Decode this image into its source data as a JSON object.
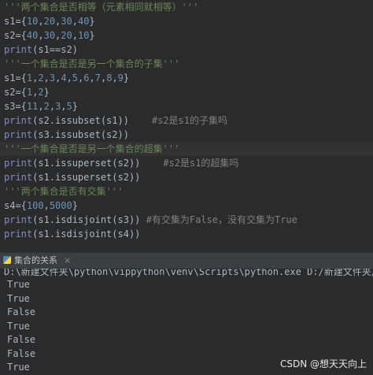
{
  "editor": {
    "lines": [
      {
        "parts": [
          {
            "t": "'''两个集合是否相等（元素相同就相等）'''",
            "c": "str"
          }
        ]
      },
      {
        "parts": [
          {
            "t": "s1={",
            "c": "op"
          },
          {
            "t": "10",
            "c": "num"
          },
          {
            "t": ",",
            "c": "op"
          },
          {
            "t": "20",
            "c": "num"
          },
          {
            "t": ",",
            "c": "op"
          },
          {
            "t": "30",
            "c": "num"
          },
          {
            "t": ",",
            "c": "op"
          },
          {
            "t": "40",
            "c": "num"
          },
          {
            "t": "}",
            "c": "op"
          }
        ]
      },
      {
        "parts": [
          {
            "t": "s2={",
            "c": "op"
          },
          {
            "t": "40",
            "c": "num"
          },
          {
            "t": ",",
            "c": "op"
          },
          {
            "t": "30",
            "c": "num"
          },
          {
            "t": ",",
            "c": "op"
          },
          {
            "t": "20",
            "c": "num"
          },
          {
            "t": ",",
            "c": "op"
          },
          {
            "t": "10",
            "c": "num"
          },
          {
            "t": "}",
            "c": "op"
          }
        ]
      },
      {
        "parts": [
          {
            "t": "print",
            "c": "fn"
          },
          {
            "t": "(s1==s2)",
            "c": "op"
          }
        ]
      },
      {
        "parts": [
          {
            "t": "'''一个集合是否是另一个集合的子集'''",
            "c": "str"
          }
        ]
      },
      {
        "parts": [
          {
            "t": "s1={",
            "c": "op"
          },
          {
            "t": "1",
            "c": "num"
          },
          {
            "t": ",",
            "c": "op"
          },
          {
            "t": "2",
            "c": "num"
          },
          {
            "t": ",",
            "c": "op"
          },
          {
            "t": "3",
            "c": "num"
          },
          {
            "t": ",",
            "c": "op"
          },
          {
            "t": "4",
            "c": "num"
          },
          {
            "t": ",",
            "c": "op"
          },
          {
            "t": "5",
            "c": "num"
          },
          {
            "t": ",",
            "c": "op"
          },
          {
            "t": "6",
            "c": "num"
          },
          {
            "t": ",",
            "c": "op"
          },
          {
            "t": "7",
            "c": "num"
          },
          {
            "t": ",",
            "c": "op"
          },
          {
            "t": "8",
            "c": "num"
          },
          {
            "t": ",",
            "c": "op"
          },
          {
            "t": "9",
            "c": "num"
          },
          {
            "t": "}",
            "c": "op"
          }
        ]
      },
      {
        "parts": [
          {
            "t": "s2={",
            "c": "op"
          },
          {
            "t": "1",
            "c": "num"
          },
          {
            "t": ",",
            "c": "op"
          },
          {
            "t": "2",
            "c": "num"
          },
          {
            "t": "}",
            "c": "op"
          }
        ]
      },
      {
        "parts": [
          {
            "t": "s3={",
            "c": "op"
          },
          {
            "t": "11",
            "c": "num"
          },
          {
            "t": ",",
            "c": "op"
          },
          {
            "t": "2",
            "c": "num"
          },
          {
            "t": ",",
            "c": "op"
          },
          {
            "t": "3",
            "c": "num"
          },
          {
            "t": ",",
            "c": "op"
          },
          {
            "t": "5",
            "c": "num"
          },
          {
            "t": "}",
            "c": "op"
          }
        ]
      },
      {
        "parts": [
          {
            "t": "print",
            "c": "fn"
          },
          {
            "t": "(s2.issubset(s1))    ",
            "c": "op"
          },
          {
            "t": "#s2是s1的子集吗",
            "c": "cmt"
          }
        ]
      },
      {
        "parts": [
          {
            "t": "print",
            "c": "fn"
          },
          {
            "t": "(s3.issubset(s2))",
            "c": "op"
          }
        ]
      },
      {
        "parts": [
          {
            "t": "'''一个集合是否是另一个集合的超集'''",
            "c": "str"
          }
        ],
        "highlight": true
      },
      {
        "parts": [
          {
            "t": "print",
            "c": "fn"
          },
          {
            "t": "(s1.issuperset(s2))    ",
            "c": "op"
          },
          {
            "t": "#s2是s1的超集吗",
            "c": "cmt"
          }
        ]
      },
      {
        "parts": [
          {
            "t": "print",
            "c": "fn"
          },
          {
            "t": "(s1.issuperset(s2))",
            "c": "op"
          }
        ]
      },
      {
        "parts": [
          {
            "t": "'''两个集合是否有交集'''",
            "c": "str"
          }
        ]
      },
      {
        "parts": [
          {
            "t": "s4={",
            "c": "op"
          },
          {
            "t": "100",
            "c": "num"
          },
          {
            "t": ",",
            "c": "op"
          },
          {
            "t": "5000",
            "c": "num"
          },
          {
            "t": "}",
            "c": "op"
          }
        ]
      },
      {
        "parts": [
          {
            "t": "print",
            "c": "fn"
          },
          {
            "t": "(s1.isdisjoint(s3)) ",
            "c": "op"
          },
          {
            "t": "#有交集为False，没有交集为True",
            "c": "cmt"
          }
        ]
      },
      {
        "parts": [
          {
            "t": "print",
            "c": "fn"
          },
          {
            "t": "(s1.isdisjoint(s4))",
            "c": "op"
          }
        ]
      }
    ]
  },
  "run_panel": {
    "tab_label": "集合的关系",
    "close_glyph": "×",
    "command": "D:\\新建文件夹\\python\\vippython\\venv\\Scripts\\python.exe D:/新建文件夹/python/vippython",
    "output": [
      "True",
      "True",
      "False",
      "True",
      "False",
      "False",
      "True"
    ]
  },
  "watermark": "CSDN @想天天向上",
  "colors": {
    "background": "#2b2b2b",
    "string": "#6a8759",
    "number": "#6897bb",
    "builtin": "#8888c6",
    "comment": "#808080",
    "text": "#a9b7c6"
  }
}
